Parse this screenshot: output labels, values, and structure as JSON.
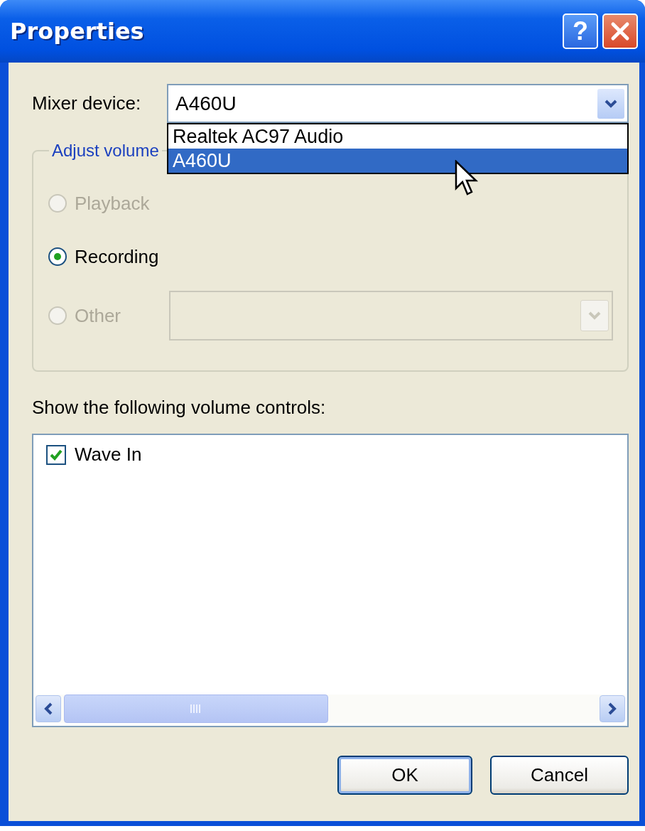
{
  "window": {
    "title": "Properties",
    "help_label": "?"
  },
  "mixer_device": {
    "label": "Mixer device:",
    "value": "A460U",
    "expanded": true,
    "options": [
      {
        "label": "Realtek AC97 Audio",
        "selected": false
      },
      {
        "label": "A460U",
        "selected": true
      }
    ]
  },
  "adjust_volume": {
    "title": "Adjust volume",
    "options": [
      {
        "kind": "plain",
        "label": "Playback",
        "selected": false,
        "disabled": true
      },
      {
        "kind": "plain",
        "label": "Recording",
        "selected": true,
        "disabled": false
      },
      {
        "kind": "combo",
        "label": "Other",
        "selected": false,
        "disabled": true
      }
    ]
  },
  "volume_controls": {
    "label": "Show the following volume controls:",
    "items": [
      {
        "label": "Wave In",
        "checked": true
      }
    ]
  },
  "buttons": [
    {
      "label": "OK",
      "default": true
    },
    {
      "label": "Cancel",
      "default": false
    }
  ]
}
